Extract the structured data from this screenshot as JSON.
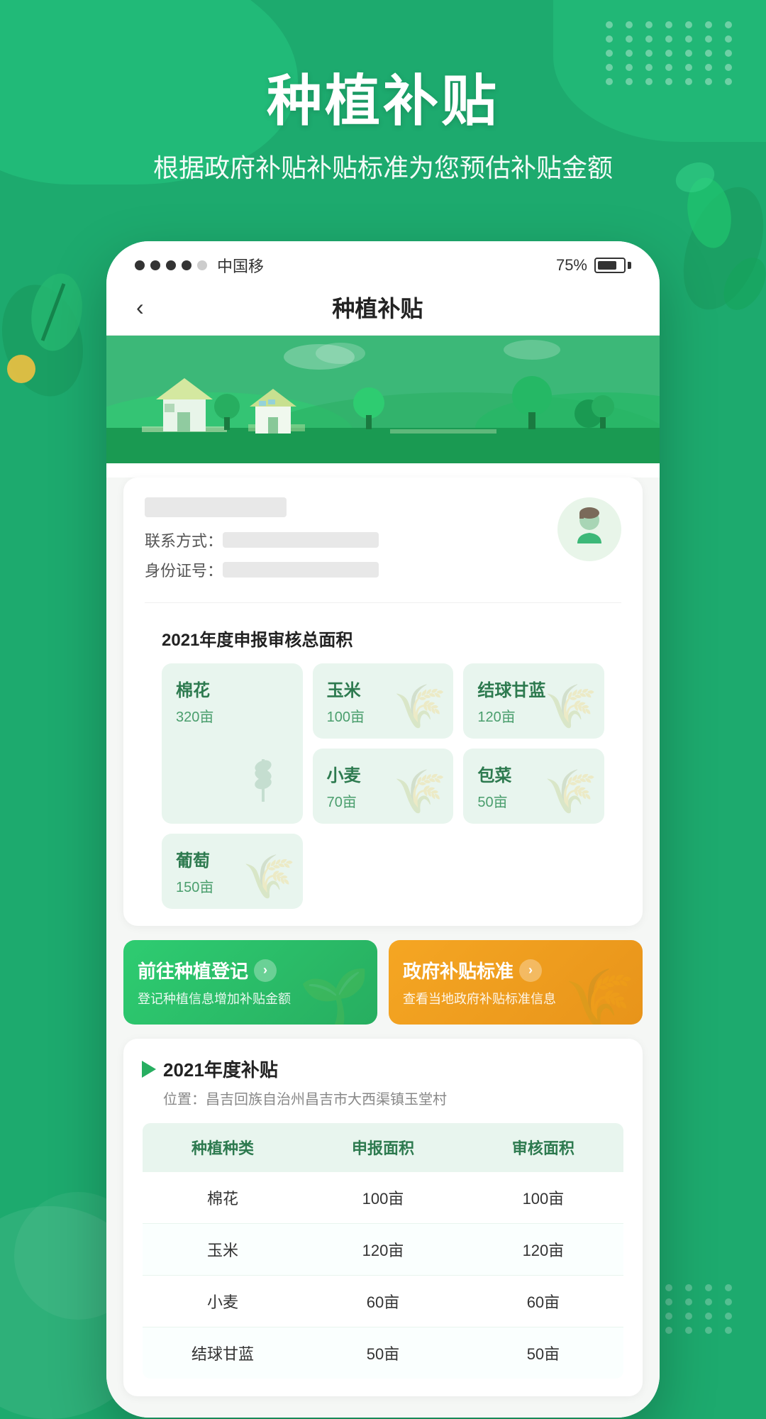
{
  "page": {
    "title": "种植补贴",
    "subtitle": "根据政府补贴补贴标准为您预估补贴金额",
    "background_color": "#1daa6e"
  },
  "status_bar": {
    "carrier": "中国移",
    "signal_dots": [
      "filled",
      "filled",
      "filled",
      "filled",
      "empty"
    ],
    "battery_percent": "75%"
  },
  "nav": {
    "back_label": "‹",
    "title": "种植补贴"
  },
  "user_card": {
    "contact_label": "联系方式：",
    "id_label": "身份证号："
  },
  "area_section": {
    "title": "2021年度申报审核总面积",
    "crops": [
      {
        "name": "棉花",
        "area": "320亩",
        "large": true
      },
      {
        "name": "玉米",
        "area": "100亩",
        "large": false
      },
      {
        "name": "结球甘蓝",
        "area": "120亩",
        "large": false
      },
      {
        "name": "小麦",
        "area": "70亩",
        "large": false
      },
      {
        "name": "包菜",
        "area": "50亩",
        "large": false
      },
      {
        "name": "葡萄",
        "area": "150亩",
        "large": false
      }
    ]
  },
  "action_buttons": {
    "register": {
      "title": "前往种植登记",
      "arrow": "›",
      "subtitle": "登记种植信息增加补贴金额"
    },
    "standard": {
      "title": "政府补贴标准",
      "arrow": "›",
      "subtitle": "查看当地政府补贴标准信息"
    }
  },
  "subsidy_section": {
    "title": "2021年度补贴",
    "location_label": "位置：昌吉回族自治州昌吉市大西渠镇玉堂村",
    "table": {
      "headers": [
        "种植种类",
        "申报面积",
        "审核面积"
      ],
      "rows": [
        {
          "crop": "棉花",
          "declared": "100亩",
          "audited": "100亩"
        },
        {
          "crop": "玉米",
          "declared": "120亩",
          "audited": "120亩"
        },
        {
          "crop": "小麦",
          "declared": "60亩",
          "audited": "60亩"
        },
        {
          "crop": "结球甘蓝",
          "declared": "50亩",
          "audited": "50亩"
        }
      ]
    }
  }
}
